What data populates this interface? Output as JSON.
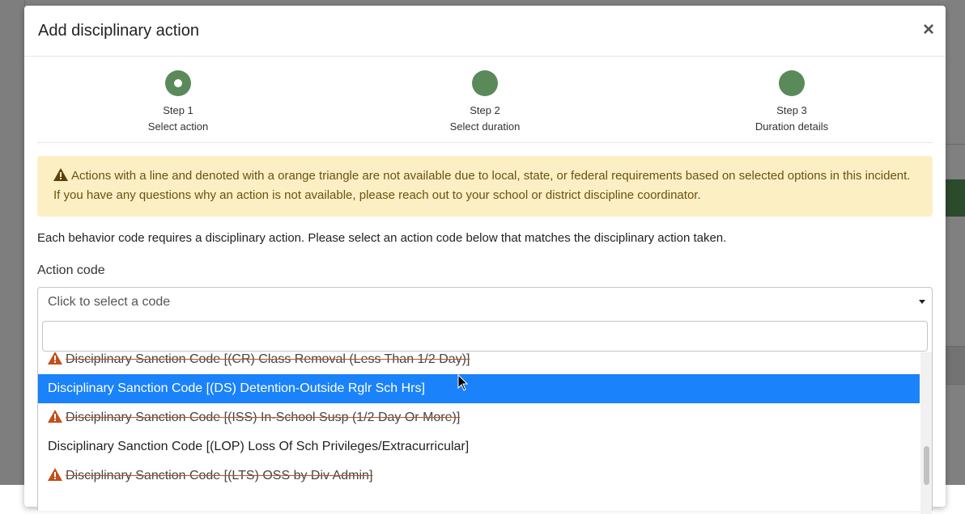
{
  "modal": {
    "title": "Add disciplinary action",
    "close_label": "×"
  },
  "steps": [
    {
      "number": "Step 1",
      "label": "Select action",
      "state": "active"
    },
    {
      "number": "Step 2",
      "label": "Select duration",
      "state": "pending"
    },
    {
      "number": "Step 3",
      "label": "Duration details",
      "state": "pending"
    }
  ],
  "alert": {
    "icon": "warning-triangle-icon",
    "text": "Actions with a line and denoted with a orange triangle are not available due to local, state, or federal requirements based on selected options in this incident. If you have any questions why an action is not available, please reach out to your school or district discipline coordinator."
  },
  "intro": "Each behavior code requires a disciplinary action. Please select an action code below that matches the disciplinary action taken.",
  "field": {
    "label": "Action code",
    "placeholder": "Click to select a code",
    "search_value": ""
  },
  "options": [
    {
      "label": "Disciplinary Sanction Code [(CR) Class Removal (Less Than 1/2 Day)]",
      "disabled": true,
      "selected": false
    },
    {
      "label": "Disciplinary Sanction Code [(DS) Detention-Outside Rglr Sch Hrs]",
      "disabled": false,
      "selected": true
    },
    {
      "label": "Disciplinary Sanction Code [(ISS) In-School Susp (1/2 Day Or More)]",
      "disabled": true,
      "selected": false
    },
    {
      "label": "Disciplinary Sanction Code [(LOP) Loss Of Sch Privileges/Extracurricular]",
      "disabled": false,
      "selected": false
    },
    {
      "label": "Disciplinary Sanction Code [(LTS) OSS by Div Admin]",
      "disabled": true,
      "selected": false
    }
  ],
  "colors": {
    "step_green": "#5a8a5a",
    "alert_bg": "#fcefc4",
    "warning_orange": "#c0501c",
    "selected_blue": "#1a82fb"
  }
}
